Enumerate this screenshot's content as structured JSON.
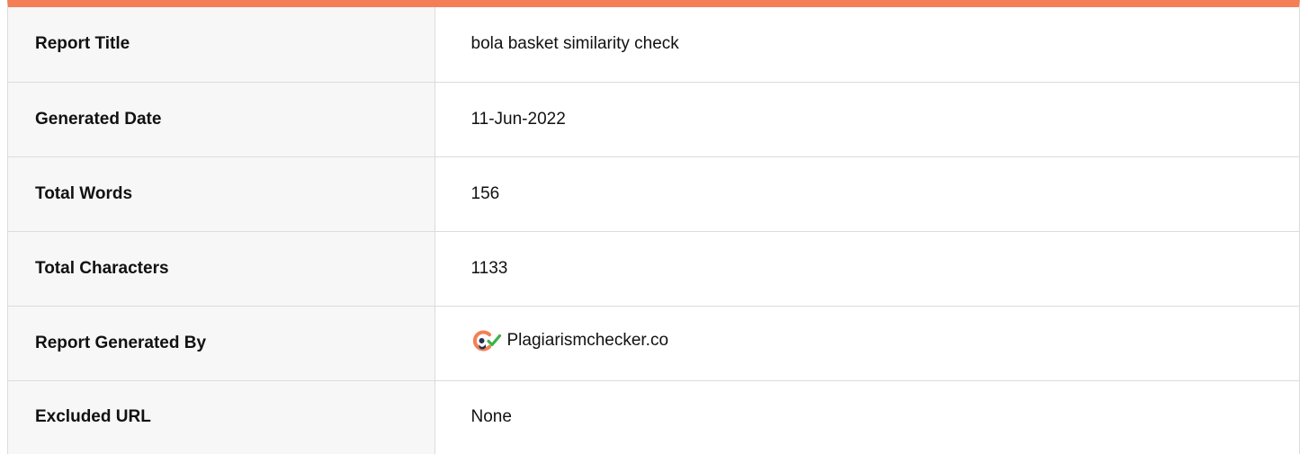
{
  "report": {
    "accent_color": "#f47f57",
    "rows": [
      {
        "label": "Report Title",
        "value": "bola basket similarity check"
      },
      {
        "label": "Generated Date",
        "value": "11-Jun-2022"
      },
      {
        "label": "Total Words",
        "value": "156"
      },
      {
        "label": "Total Characters",
        "value": "1133"
      },
      {
        "label": "Report Generated By",
        "value": "Plagiarismchecker.co",
        "icon": "plagiarismchecker-logo-icon"
      },
      {
        "label": "Excluded URL",
        "value": "None"
      }
    ]
  }
}
